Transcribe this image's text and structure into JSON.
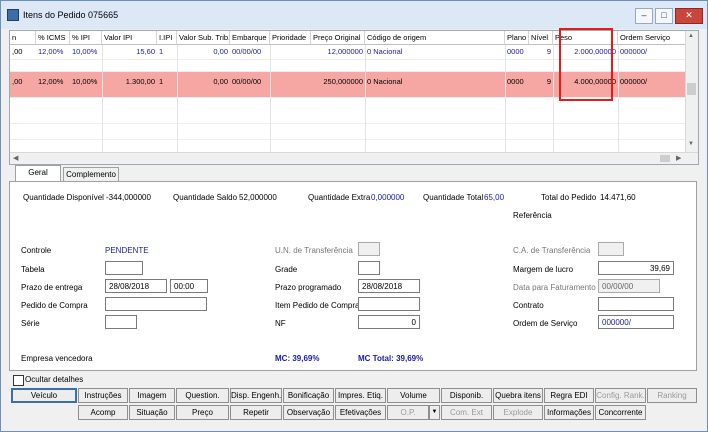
{
  "window": {
    "title": "Itens do Pedido 075665",
    "controls": [
      "–",
      "□",
      "✕"
    ]
  },
  "grid": {
    "headers": [
      "n",
      "% ICMS",
      "% IPI",
      "Valor IPI",
      "I.IPI",
      "Valor Sub. Trib.",
      "Embarque",
      "Prioridade",
      "Preço Original",
      "Código de origem",
      "Plano",
      "Nível",
      "Peso",
      "Ordem Serviço"
    ],
    "rows": [
      {
        "n": ",00",
        "icms": "12,00%",
        "ipi": "10,00%",
        "valor_ipi": "15,60",
        "iipi": "1",
        "sub_trib": "0,00",
        "embarque": "00/00/00",
        "prioridade": "",
        "preco": "12,000000",
        "origem": "0 Nacional",
        "plano": "0000",
        "nivel": "9",
        "peso": "2.000,00000",
        "os": "000000/"
      },
      {
        "n": ",00",
        "icms": "12,00%",
        "ipi": "10,00%",
        "valor_ipi": "1.300,00",
        "iipi": "1",
        "sub_trib": "0,00",
        "embarque": "00/00/00",
        "prioridade": "",
        "preco": "250,000000",
        "origem": "0 Nacional",
        "plano": "0000",
        "nivel": "9",
        "peso": "4.000,00000",
        "os": "000000/"
      }
    ]
  },
  "tabs": [
    "Geral",
    "Complemento"
  ],
  "summary": {
    "qtd_disponivel_label": "Quantidade Disponível",
    "qtd_disponivel": "-344,000000",
    "qtd_saldo_label": "Quantidade Saldo",
    "qtd_saldo": "52,000000",
    "qtd_extra_label": "Quantidade Extra",
    "qtd_extra": "0,000000",
    "qtd_total_label": "Quantidade Total",
    "qtd_total": "65,00",
    "total_pedido_label": "Total do Pedido",
    "total_pedido": "14.471,60",
    "referencia_label": "Referência"
  },
  "form": {
    "controle_label": "Controle",
    "controle": "PENDENTE",
    "tabela_label": "Tabela",
    "tabela": "",
    "prazo_entrega_label": "Prazo de entrega",
    "prazo_entrega": "28/08/2018",
    "hora": "00:00",
    "pedido_compra_label": "Pedido de Compra",
    "pedido_compra": "",
    "serie_label": "Série",
    "serie": "",
    "un_transf_label": "U.N. de Transferência",
    "un_transf": "",
    "grade_label": "Grade",
    "grade": "",
    "prazo_prog_label": "Prazo programado",
    "prazo_prog": "28/08/2018",
    "item_pedido_label": "Item Pedido de Compra",
    "item_pedido": "",
    "nf_label": "NF",
    "nf": "0",
    "ca_transf_label": "C.A. de Transferência",
    "ca_transf": "",
    "margem_label": "Margem de lucro",
    "margem": "39,69",
    "data_fat_label": "Data para Faturamento",
    "data_fat": "00/00/00",
    "contrato_label": "Contrato",
    "contrato": "",
    "ordem_servico_label": "Ordem de Serviço",
    "ordem_servico": "000000/",
    "empresa_label": "Empresa vencedora",
    "mc": "MC: 39,69%",
    "mc_total": "MC Total: 39,69%"
  },
  "ocultar_label": "Ocultar detalhes",
  "buttons_row1": [
    "Veículo",
    "Instruções",
    "Imagem",
    "Question.",
    "Disp. Engenh.",
    "Bonificação",
    "Impres. Etiq.",
    "Volume",
    "Disponib.",
    "Quebra itens",
    "Regra EDI",
    "Config. Rank.",
    "Ranking"
  ],
  "buttons_row2": [
    "Acomp",
    "Situação",
    "Preço",
    "Repetir",
    "Observação",
    "Efetivações",
    "O.P.",
    "▼",
    "Com. Ext",
    "Explode",
    "Informações",
    "Concorrente"
  ],
  "colors": {
    "selected_row": "#f7a7a3",
    "highlight_box": "#e21b1b",
    "value_blue": "#1a1aa6"
  }
}
